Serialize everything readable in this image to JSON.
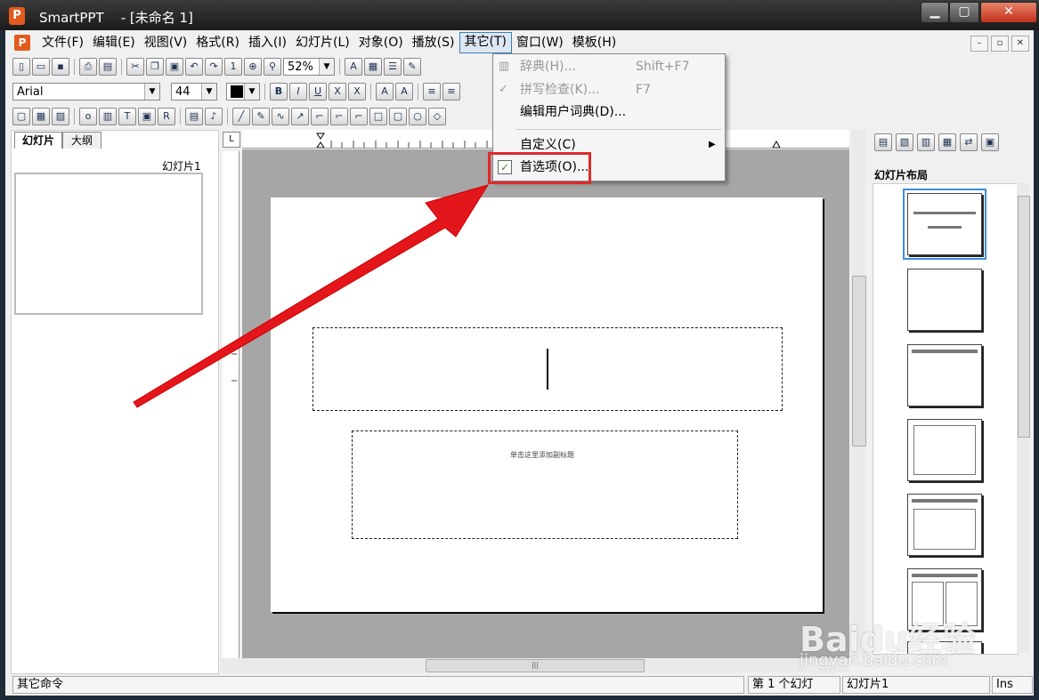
{
  "window": {
    "app_icon": "P",
    "title": "SmartPPT    - [未命名 1]",
    "min": "▁",
    "max": "▢",
    "close": "✕"
  },
  "menu": {
    "items": [
      "文件(F)",
      "编辑(E)",
      "视图(V)",
      "格式(R)",
      "插入(I)",
      "幻灯片(L)",
      "对象(O)",
      "播放(S)",
      "其它(T)",
      "窗口(W)",
      "模板(H)"
    ],
    "active_index": 8
  },
  "toolbar": {
    "zoom": "52%",
    "font": "Arial",
    "font_size": "44"
  },
  "left_panel": {
    "tab_slides": "幻灯片",
    "tab_outline": "大纲",
    "slide_label": "幻灯片1"
  },
  "slide": {
    "subtitle_placeholder": "单击这里添加副标题"
  },
  "right_panel": {
    "header": "幻灯片布局"
  },
  "dropdown": {
    "items": [
      {
        "label": "辞典(H)...",
        "shortcut": "Shift+F7",
        "disabled": true
      },
      {
        "label": "拼写检查(K)...",
        "shortcut": "F7",
        "disabled": true
      },
      {
        "label": "编辑用户词典(D)...",
        "shortcut": "",
        "disabled": false
      },
      {
        "label": "自定义(C)",
        "shortcut": "",
        "disabled": false
      },
      {
        "label": "首选项(O)...",
        "shortcut": "",
        "disabled": false
      }
    ]
  },
  "status": {
    "message": "其它命令",
    "slide_count": "第 1 个幻灯",
    "slide_name": "幻灯片1",
    "mode": "Ins"
  },
  "watermark": {
    "main": "Baidu经验",
    "sub": "jingyan.baidu.com"
  },
  "colors": {
    "highlight": "#e0282b",
    "arrow": "#e3161b",
    "brand": "#e25b1d"
  }
}
